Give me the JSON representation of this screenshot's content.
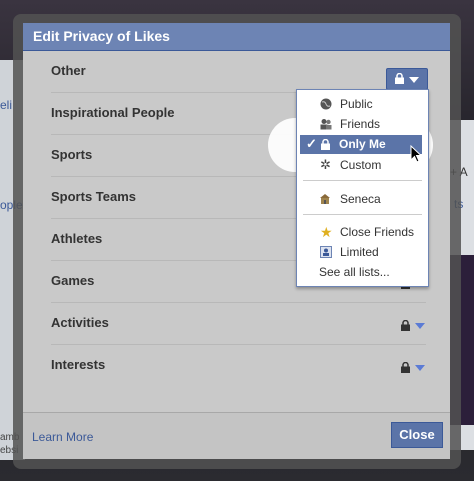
{
  "dialog": {
    "title": "Edit Privacy of Likes",
    "footer_link": "Learn More",
    "close_label": "Close"
  },
  "rows": [
    {
      "label": "Other"
    },
    {
      "label": "Inspirational People"
    },
    {
      "label": "Sports"
    },
    {
      "label": "Sports Teams"
    },
    {
      "label": "Athletes"
    },
    {
      "label": "Games"
    },
    {
      "label": "Activities"
    },
    {
      "label": "Interests"
    }
  ],
  "menu": {
    "items": [
      {
        "label": "Public",
        "icon": "globe-icon"
      },
      {
        "label": "Friends",
        "icon": "friends-icon"
      },
      {
        "label": "Only Me",
        "icon": "lock-icon",
        "selected": true
      },
      {
        "label": "Custom",
        "icon": "gear-icon"
      },
      {
        "label": "Seneca",
        "icon": "school-icon"
      },
      {
        "label": "Close Friends",
        "icon": "star-icon"
      },
      {
        "label": "Limited",
        "icon": "limited-icon"
      },
      {
        "label": "See all lists..."
      }
    ]
  },
  "background": {
    "left_fragments": [
      "eli",
      "ople",
      "amb",
      "ebsi"
    ],
    "right_fragments": [
      "+ A",
      "ts"
    ]
  },
  "colors": {
    "header": "#6d84b4",
    "accent": "#5b74a8",
    "caret": "#5b7bd5"
  }
}
